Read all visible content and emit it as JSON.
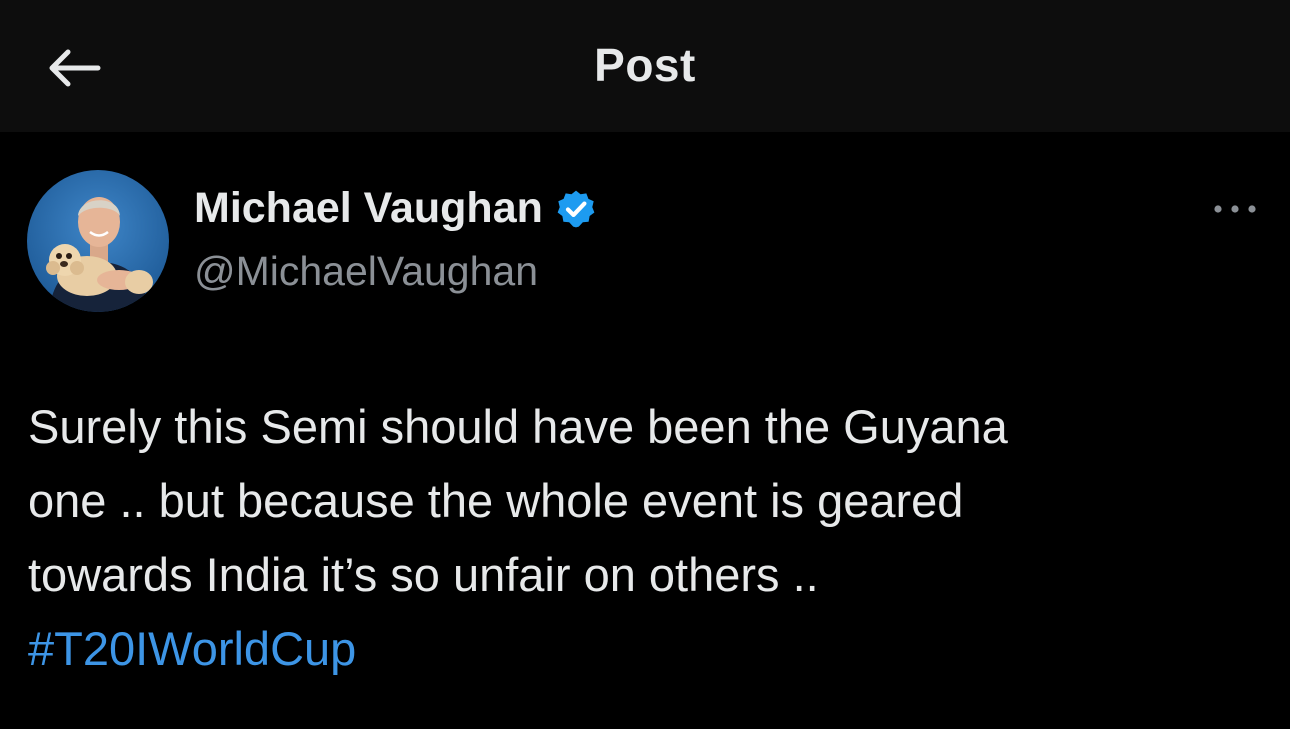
{
  "header": {
    "title": "Post",
    "back_icon": "arrow-left-icon"
  },
  "post": {
    "author": {
      "name": "Michael Vaughan",
      "handle": "@MichaelVaughan",
      "verified_icon": "verified-badge-icon",
      "verified_color": "#1d9bf0",
      "avatar": "profile-photo"
    },
    "more_icon": "more-horizontal-icon",
    "text_lines": [
      "Surely this Semi should have been the Guyana",
      "one .. but because the whole event is geared",
      "towards India it’s so unfair on others .."
    ],
    "hashtag": "#T20IWorldCup"
  },
  "colors": {
    "background": "#000000",
    "header_background": "#0d0d0d",
    "text": "#e7e9ea",
    "secondary_text": "#8b9096",
    "link": "#3d95e6"
  }
}
